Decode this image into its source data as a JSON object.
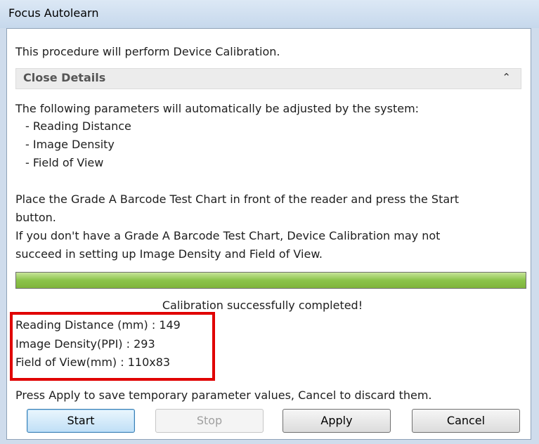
{
  "window": {
    "title": "Focus Autolearn"
  },
  "intro": "This procedure will perform Device Calibration.",
  "details": {
    "toggle_label": "Close Details",
    "heading": "The following parameters will automatically be adjusted by the system:",
    "items": [
      "- Reading Distance",
      "- Image Density",
      "- Field of View"
    ],
    "instructions": [
      "Place the Grade A Barcode Test Chart in front of the reader and press the Start",
      "button.",
      "If you don't have a Grade A Barcode Test Chart, Device Calibration may not",
      "succeed in setting up Image Density and Field of View."
    ]
  },
  "progress": {
    "value": 1.0,
    "color": "#8bc34a"
  },
  "status": "Calibration successfully completed!",
  "results": [
    {
      "label": "Reading Distance (mm) :",
      "value": "149"
    },
    {
      "label": "Image Density(PPI) :",
      "value": "293"
    },
    {
      "label": "Field of View(mm) :",
      "value": "110x83"
    }
  ],
  "footer_note": "Press Apply to save temporary parameter values, Cancel to discard them.",
  "buttons": {
    "start": "Start",
    "stop": "Stop",
    "apply": "Apply",
    "cancel": "Cancel"
  },
  "icons": {
    "expander": "chevron-up-icon"
  },
  "colors": {
    "highlight": "#e00000",
    "title_bar": "#cfdcec"
  }
}
